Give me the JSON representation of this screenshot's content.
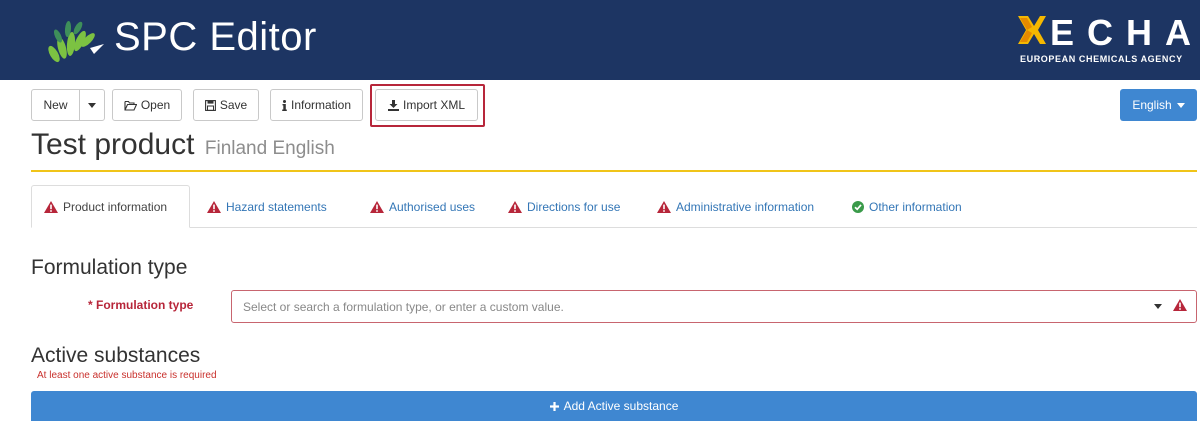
{
  "app": {
    "title": "SPC Editor"
  },
  "echa": {
    "letters": "ECHA",
    "subtitle": "EUROPEAN CHEMICALS AGENCY"
  },
  "toolbar": {
    "new_label": "New",
    "open_label": "Open",
    "save_label": "Save",
    "info_label": "Information",
    "import_label": "Import XML",
    "language_label": "English"
  },
  "page": {
    "title": "Test product",
    "subtitle": "Finland English"
  },
  "tabs": [
    {
      "label": "Product information",
      "status": "warning",
      "active": true
    },
    {
      "label": "Hazard statements",
      "status": "warning"
    },
    {
      "label": "Authorised uses",
      "status": "warning"
    },
    {
      "label": "Directions for use",
      "status": "warning"
    },
    {
      "label": "Administrative information",
      "status": "warning"
    },
    {
      "label": "Other information",
      "status": "ok"
    }
  ],
  "formulation": {
    "section_title": "Formulation type",
    "field_label": "* Formulation type",
    "placeholder": "Select or search a formulation type, or enter a custom value."
  },
  "active_substances": {
    "section_title": "Active substances",
    "error": "At least one active substance is required",
    "add_label": "Add Active substance"
  },
  "colors": {
    "header_bg": "#1d3563",
    "accent_blue": "#3f87d1",
    "warning_red": "#b7263a",
    "ok_green": "#3a9a4a",
    "divider_yellow": "#f0c419"
  }
}
